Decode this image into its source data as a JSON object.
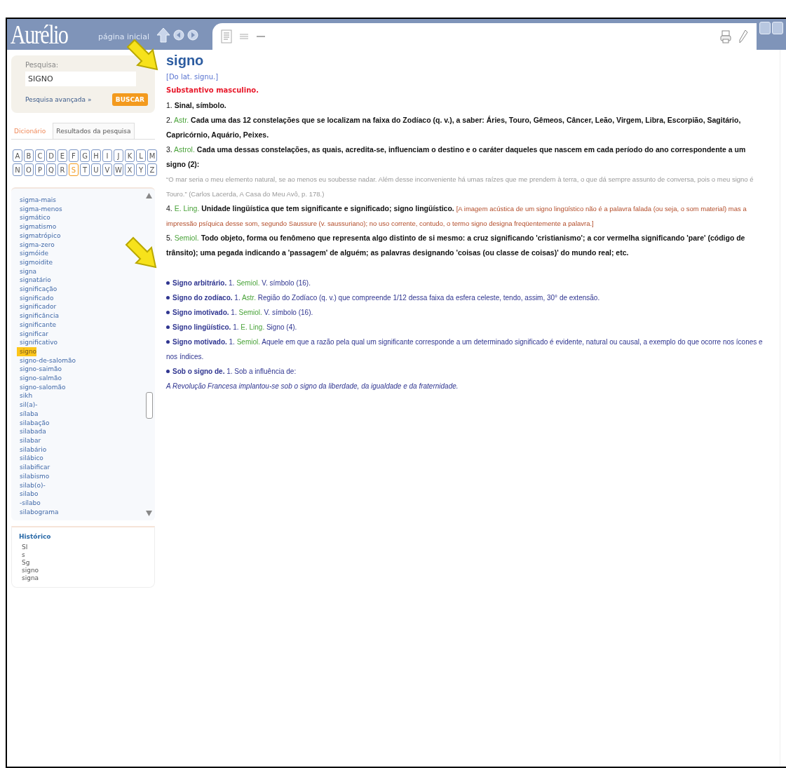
{
  "header": {
    "logo": "Aurélio",
    "home_link": "página inicial"
  },
  "search": {
    "label": "Pesquisa:",
    "value": "SIGNO",
    "advanced_link": "Pesquisa avançada »",
    "button": "BUSCAR"
  },
  "tabs": [
    {
      "label": "Dicionário",
      "selected": true
    },
    {
      "label": "Resultados da pesquisa",
      "selected": false
    }
  ],
  "letters": [
    {
      "label": "A",
      "selected": false
    },
    {
      "label": "B",
      "selected": false
    },
    {
      "label": "C",
      "selected": false
    },
    {
      "label": "D",
      "selected": false
    },
    {
      "label": "E",
      "selected": false
    },
    {
      "label": "F",
      "selected": false
    },
    {
      "label": "G",
      "selected": false
    },
    {
      "label": "H",
      "selected": false
    },
    {
      "label": "I",
      "selected": false
    },
    {
      "label": "J",
      "selected": false
    },
    {
      "label": "K",
      "selected": false
    },
    {
      "label": "L",
      "selected": false
    },
    {
      "label": "M",
      "selected": false
    },
    {
      "label": "N",
      "selected": false
    },
    {
      "label": "O",
      "selected": false
    },
    {
      "label": "P",
      "selected": false
    },
    {
      "label": "Q",
      "selected": false
    },
    {
      "label": "R",
      "selected": false
    },
    {
      "label": "S",
      "selected": true
    },
    {
      "label": "T",
      "selected": false
    },
    {
      "label": "U",
      "selected": false
    },
    {
      "label": "V",
      "selected": false
    },
    {
      "label": "W",
      "selected": false
    },
    {
      "label": "X",
      "selected": false
    },
    {
      "label": "Y",
      "selected": false
    },
    {
      "label": "Z",
      "selected": false
    }
  ],
  "word_list": [
    {
      "label": "sigma-mais",
      "selected": false
    },
    {
      "label": "sigma-menos",
      "selected": false
    },
    {
      "label": "sigmático",
      "selected": false
    },
    {
      "label": "sigmatismo",
      "selected": false
    },
    {
      "label": "sigmatrópico",
      "selected": false
    },
    {
      "label": "sigma-zero",
      "selected": false
    },
    {
      "label": "sigmóide",
      "selected": false
    },
    {
      "label": "sigmoidite",
      "selected": false
    },
    {
      "label": "signa",
      "selected": false
    },
    {
      "label": "signatário",
      "selected": false
    },
    {
      "label": "significação",
      "selected": false
    },
    {
      "label": "significado",
      "selected": false
    },
    {
      "label": "significador",
      "selected": false
    },
    {
      "label": "significância",
      "selected": false
    },
    {
      "label": "significante",
      "selected": false
    },
    {
      "label": "significar",
      "selected": false
    },
    {
      "label": "significativo",
      "selected": false
    },
    {
      "label": "signo",
      "selected": true
    },
    {
      "label": "signo-de-salomão",
      "selected": false
    },
    {
      "label": "signo-saimão",
      "selected": false
    },
    {
      "label": "signo-salmão",
      "selected": false
    },
    {
      "label": "signo-salomão",
      "selected": false
    },
    {
      "label": "sikh",
      "selected": false
    },
    {
      "label": "sil(a)-",
      "selected": false
    },
    {
      "label": "sílaba",
      "selected": false
    },
    {
      "label": "silabação",
      "selected": false
    },
    {
      "label": "silabada",
      "selected": false
    },
    {
      "label": "silabar",
      "selected": false
    },
    {
      "label": "silabário",
      "selected": false
    },
    {
      "label": "silábico",
      "selected": false
    },
    {
      "label": "silabificar",
      "selected": false
    },
    {
      "label": "silabismo",
      "selected": false
    },
    {
      "label": "silab(o)-",
      "selected": false
    },
    {
      "label": "silabo",
      "selected": false
    },
    {
      "label": "-sílabo",
      "selected": false
    },
    {
      "label": "silabograma",
      "selected": false
    }
  ],
  "history": {
    "title": "Histórico",
    "items": [
      "SI",
      "s",
      "Sg",
      "signo",
      "signa"
    ]
  },
  "entry": {
    "headword": "signo",
    "etymology": "[Do lat. signu.]",
    "class": "Substantivo masculino.",
    "senses": [
      {
        "number": "1.",
        "text": "Sinal, símbolo."
      },
      {
        "number": "2.",
        "area": "Astr.",
        "text": "Cada uma das 12 constelações que se localizam na faixa do Zodíaco (q. v.), a saber: Áries, Touro, Gêmeos, Câncer, Leão, Virgem, Libra, Escorpião, Sagitário, Capricórnio, Aquário, Peixes."
      },
      {
        "number": "3.",
        "area": "Astrol.",
        "text": "Cada uma dessas constelações, as quais, acredita-se, influenciam o destino e o caráter daqueles que nascem em cada período do ano correspondente a um signo (2):",
        "quote": "“O mar seria o meu elemento natural, se ao menos eu soubesse nadar. Além desse inconveniente há umas raízes que me prendem à terra, o que dá sempre assunto de conversa, pois o meu signo é Touro.” (Carlos Lacerda, A Casa do Meu Avô, p. 178.)"
      },
      {
        "number": "4.",
        "area": "E. Ling.",
        "text": "Unidade lingüística que tem significante e significado; signo lingüístico.",
        "note": "[A imagem acústica de um signo lingüístico não é a palavra falada (ou seja, o som material) mas a impressão psíquica desse som, segundo Saussure (v. saussuriano); no uso corrente, contudo, o termo signo designa freqüentemente a palavra.]"
      },
      {
        "number": "5.",
        "area": "Semiol.",
        "text": "Todo objeto, forma ou fenômeno que representa algo distinto de si mesmo: a cruz significando 'cristianismo'; a cor vermelha significando 'pare' (código de trânsito); uma pegada indicando a 'passagem' de alguém; as palavras designando 'coisas (ou classe de coisas)' do mundo real; etc."
      }
    ],
    "phrases": [
      {
        "head": "Signo arbitrário.",
        "number": "1.",
        "area": "Semiol.",
        "text": "V. símbolo (16)."
      },
      {
        "head": "Signo do zodíaco.",
        "number": "1.",
        "area": "Astr.",
        "text": "Região do Zodíaco (q. v.) que compreende 1/12 dessa faixa da esfera celeste, tendo, assim, 30° de extensão."
      },
      {
        "head": "Signo imotivado.",
        "number": "1.",
        "area": "Semiol.",
        "text": "V. símbolo (16)."
      },
      {
        "head": "Signo lingüístico.",
        "number": "1.",
        "area": "E. Ling.",
        "text": "Signo (4)."
      },
      {
        "head": "Signo motivado.",
        "number": "1.",
        "area": "Semiol.",
        "text": "Aquele em que a razão pela qual um significante corresponde a um determinado significado é evidente, natural ou causal, a exemplo do que ocorre nos ícones e nos índices."
      },
      {
        "head": "Sob o signo de.",
        "number": "1.",
        "text": "Sob a influência de:",
        "example": "A Revolução Francesa implantou-se sob o signo da liberdade, da igualdade e da fraternidade."
      }
    ]
  }
}
